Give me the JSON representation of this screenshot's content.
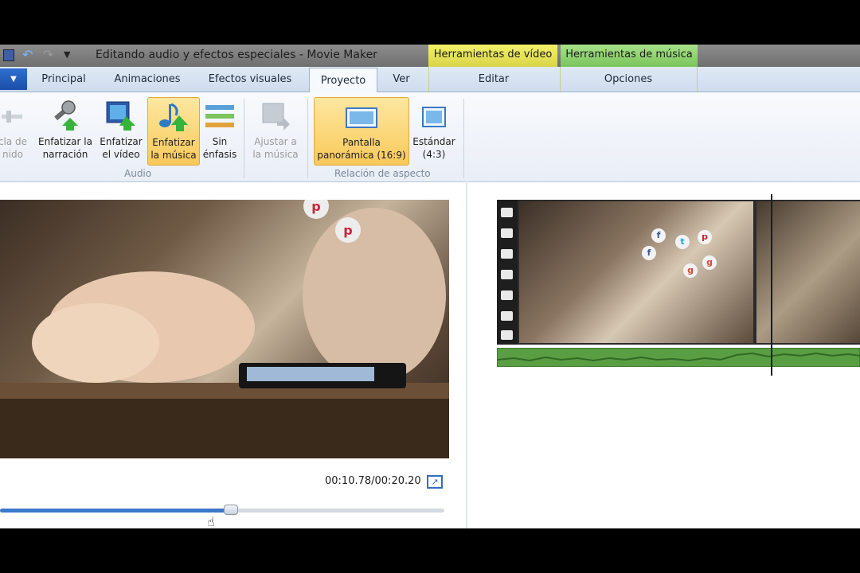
{
  "window": {
    "title": "Editando audio y efectos especiales - Movie Maker",
    "context_tabs": {
      "video": "Herramientas de vídeo",
      "music": "Herramientas de música"
    }
  },
  "tabs": {
    "file": "▼",
    "principal": "Principal",
    "animaciones": "Animaciones",
    "efectos": "Efectos visuales",
    "proyecto": "Proyecto",
    "ver": "Ver",
    "editar": "Editar",
    "opciones": "Opciones"
  },
  "ribbon": {
    "mezcla": {
      "line1": "cla de",
      "line2": "nido"
    },
    "narracion": {
      "line1": "Enfatizar la",
      "line2": "narración"
    },
    "video": {
      "line1": "Enfatizar",
      "line2": "el vídeo"
    },
    "musica": {
      "line1": "Enfatizar",
      "line2": "la música"
    },
    "sin": {
      "line1": "Sin",
      "line2": "énfasis"
    },
    "ajustar": {
      "line1": "Ajustar a",
      "line2": "la música"
    },
    "panoramica": {
      "line1": "Pantalla",
      "line2": "panorámica (16:9)"
    },
    "estandar": {
      "line1": "Estándar",
      "line2": "(4:3)"
    },
    "group_audio": "Audio",
    "group_aspect": "Relación de aspecto"
  },
  "player": {
    "timecode": "00:10.78/00:20.20",
    "progress": 0.52
  },
  "colors": {
    "accent": "#3b78c9",
    "selected": "#f8c95a",
    "video_tools": "#e6e25a",
    "music_tools": "#8fd36f"
  },
  "icons": {
    "social_bubbles": [
      "f",
      "t",
      "p",
      "g+"
    ]
  }
}
